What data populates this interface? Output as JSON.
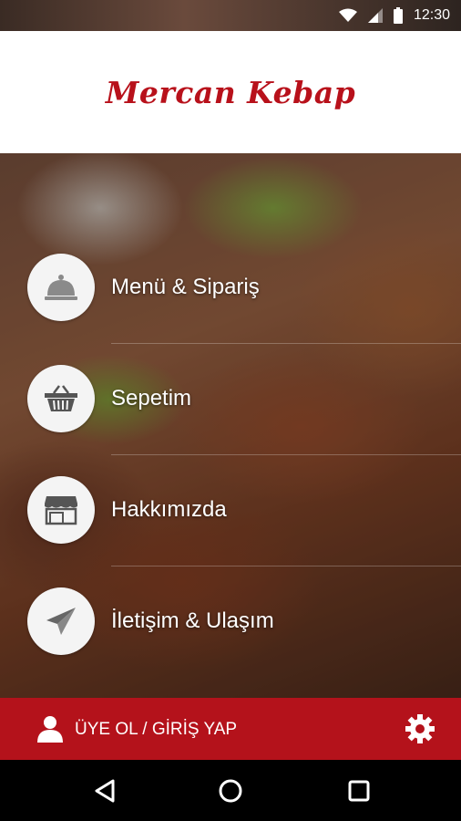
{
  "status_bar": {
    "time": "12:30"
  },
  "header": {
    "brand": "Mercan Kebap"
  },
  "menu": {
    "items": [
      {
        "label": "Menü & Sipariş",
        "icon": "cloche-icon"
      },
      {
        "label": "Sepetim",
        "icon": "basket-icon"
      },
      {
        "label": "Hakkımızda",
        "icon": "storefront-icon"
      },
      {
        "label": "İletişim & Ulaşım",
        "icon": "paper-plane-icon"
      }
    ]
  },
  "bottom_bar": {
    "login_label": "ÜYE OL / GİRİŞ YAP"
  },
  "colors": {
    "brand_red": "#b8111b",
    "bar_red": "#b4121b"
  }
}
